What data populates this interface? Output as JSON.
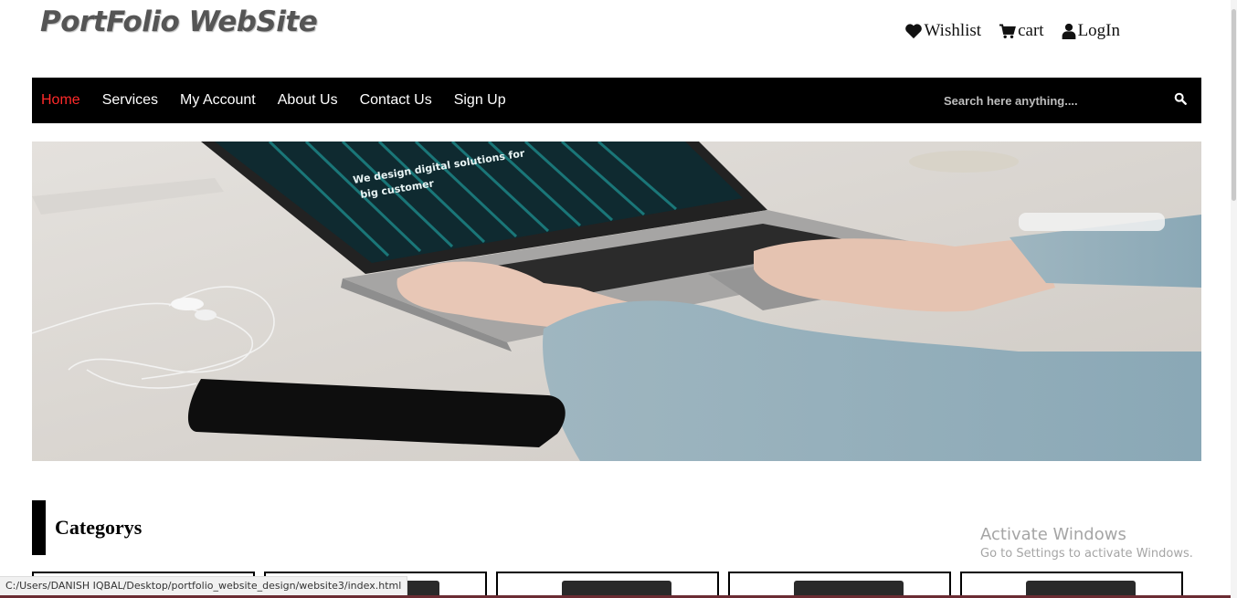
{
  "logo": {
    "text": "PortFolio WebSite"
  },
  "top_links": [
    {
      "label": "Wishlist",
      "icon": "heart-icon"
    },
    {
      "label": "cart",
      "icon": "cart-icon"
    },
    {
      "label": "LogIn",
      "icon": "user-icon"
    }
  ],
  "nav": {
    "items": [
      {
        "label": "Home",
        "active": true
      },
      {
        "label": "Services"
      },
      {
        "label": "My Account"
      },
      {
        "label": "About Us"
      },
      {
        "label": "Contact Us"
      },
      {
        "label": "Sign Up"
      }
    ],
    "active_color": "#ff2a2a"
  },
  "search": {
    "placeholder": "Search here anything....",
    "value": ""
  },
  "hero": {
    "screen_line1": "We design digital solutions for",
    "screen_line2": "big customer"
  },
  "categories": {
    "title": "Categorys"
  },
  "watermark": {
    "line1": "Activate Windows",
    "line2": "Go to Settings to activate Windows."
  },
  "statusbar": {
    "text": "C:/Users/DANISH IQBAL/Desktop/portfolio_website_design/website3/index.html"
  }
}
